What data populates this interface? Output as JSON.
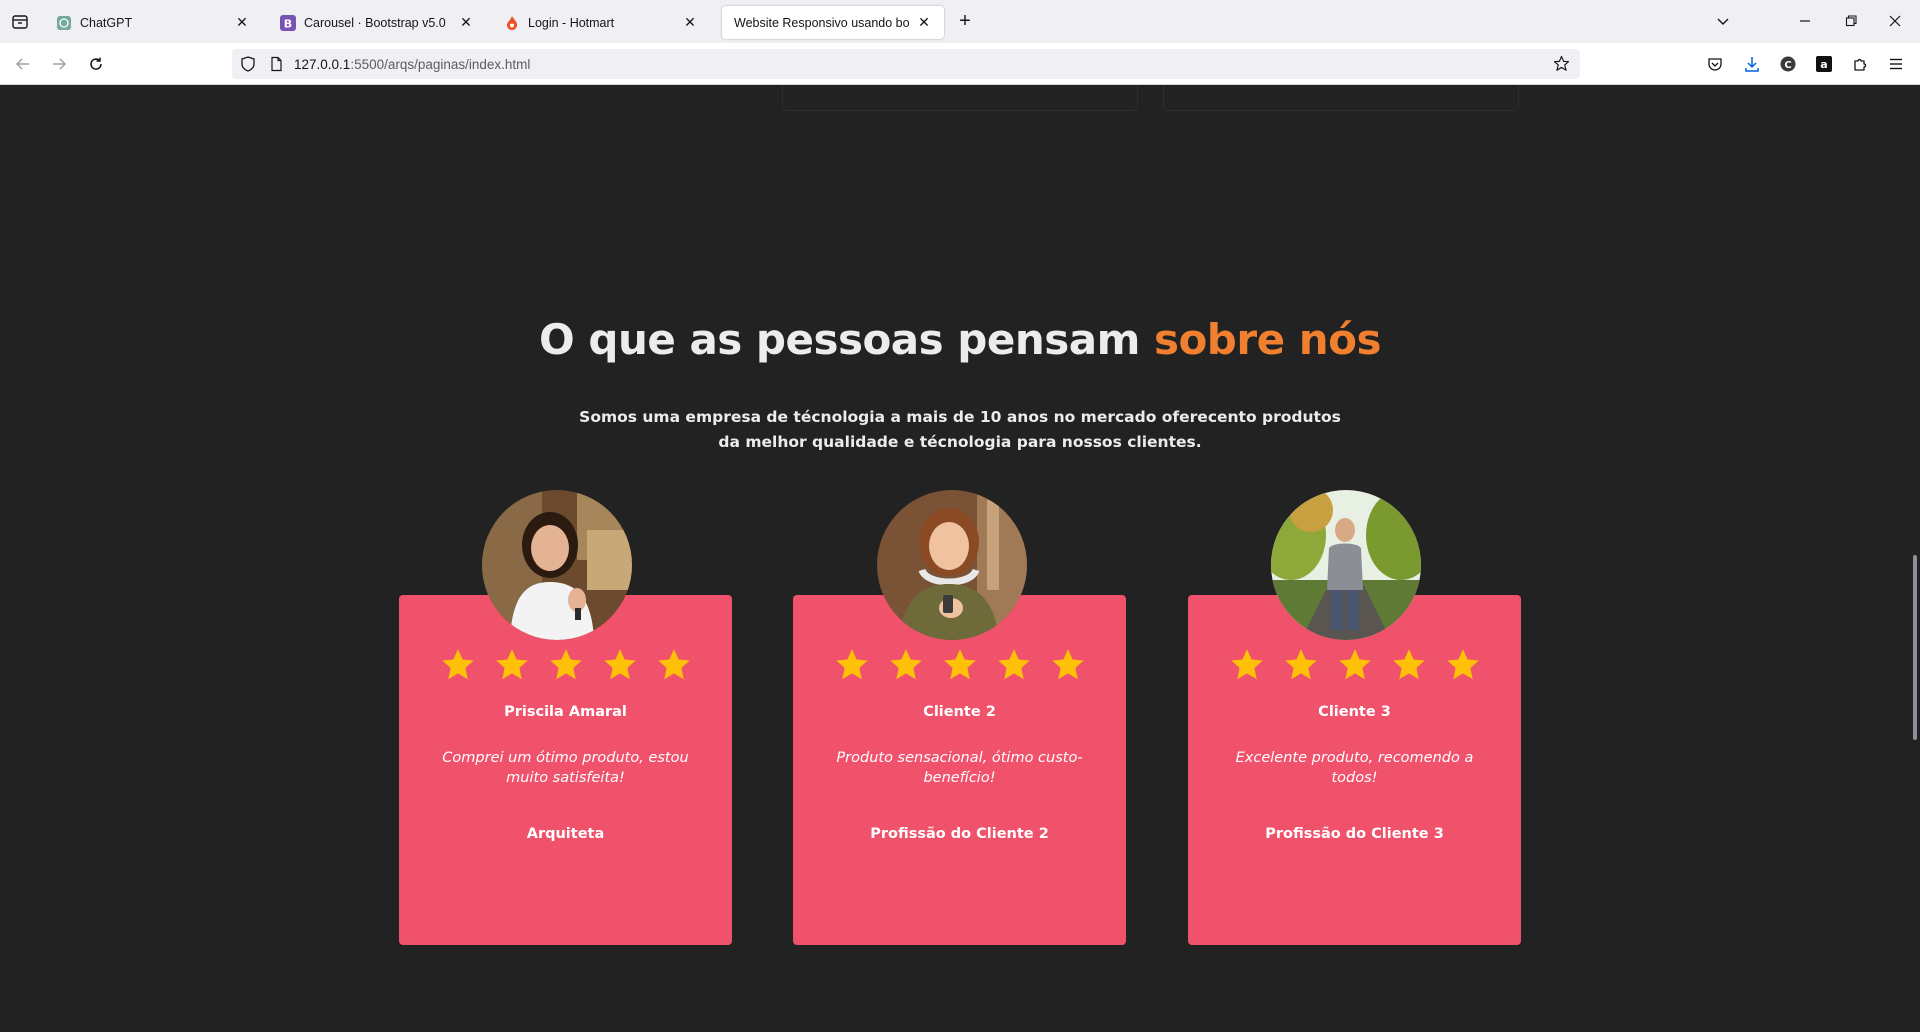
{
  "browser": {
    "tabs": [
      {
        "title": "ChatGPT"
      },
      {
        "title": "Carousel · Bootstrap v5.0"
      },
      {
        "title": "Login - Hotmart"
      },
      {
        "title": "Website Responsivo usando bootstrap"
      }
    ],
    "url_host": "127.0.0.1",
    "url_path": ":5500/arqs/paginas/index.html"
  },
  "section": {
    "heading_main": "O que as pessoas pensam",
    "heading_accent": "sobre nós",
    "subtext": "Somos uma empresa de técnologia a mais de 10 anos no mercado oferecento produtos da melhor qualidade e técnologia para nossos clientes."
  },
  "testimonials": [
    {
      "name": "Priscila Amaral",
      "quote": "Comprei um ótimo produto, estou muito satisfeita!",
      "job": "Arquiteta",
      "rating": 5
    },
    {
      "name": "Cliente 2",
      "quote": "Produto sensacional, ótimo custo-benefício!",
      "job": "Profissão do Cliente 2",
      "rating": 5
    },
    {
      "name": "Cliente 3",
      "quote": "Excelente produto, recomendo a todos!",
      "job": "Profissão do Cliente 3",
      "rating": 5
    }
  ],
  "colors": {
    "page_bg": "#222222",
    "accent": "#f08030",
    "card_bg": "#f0526b",
    "star": "#ffc107"
  }
}
